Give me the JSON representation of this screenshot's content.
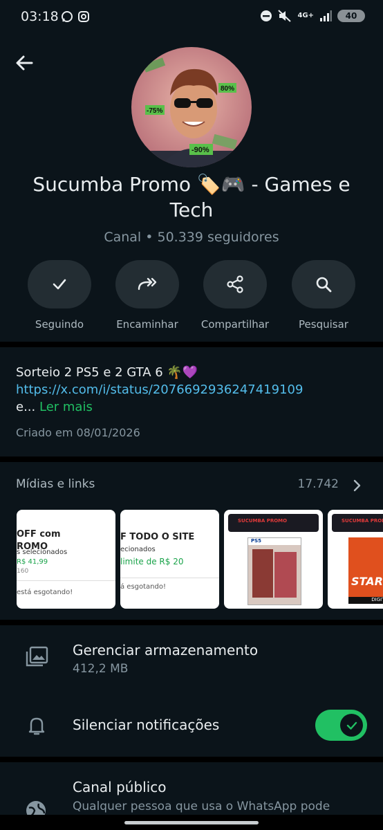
{
  "status_bar": {
    "time": "03:18",
    "network": "4G+",
    "battery": "40"
  },
  "channel": {
    "name": "Sucumba Promo 🏷️🎮  - Games e Tech",
    "subtitle": "Canal • 50.339 seguidores",
    "avatar_badges": [
      "80%",
      "-75%",
      "-90%"
    ]
  },
  "actions": [
    {
      "label": "Seguindo",
      "icon": "check-icon"
    },
    {
      "label": "Encaminhar",
      "icon": "forward-icon"
    },
    {
      "label": "Compartilhar",
      "icon": "share-icon"
    },
    {
      "label": "Pesquisar",
      "icon": "search-icon"
    }
  ],
  "description": {
    "text": "Sorteio 2 PS5 e 2 GTA 6 🌴💜",
    "link": "https://x.com/i/status/2076692936247419109",
    "ellipsis": "e...",
    "more": "Ler mais",
    "created": "Criado em 08/01/2026"
  },
  "media": {
    "header": "Mídias e links",
    "count": "17.742",
    "thumbs": [
      {
        "line1": "OFF com",
        "line2": "ROMO",
        "line3": "s selecionados",
        "price": "R$ 41,99",
        "old": "160",
        "footer": "está esgotando!"
      },
      {
        "line1": "F TODO O SITE",
        "line3": "ecionados",
        "price": "limite de R$ 20",
        "footer": "á esgotando!"
      },
      {
        "brand": "SUCUMBA PROMO",
        "platform": "PS5"
      },
      {
        "brand": "SUCUMBA PROMO",
        "game_text": "STAR",
        "tag": "DIGITA"
      }
    ]
  },
  "settings": {
    "storage_title": "Gerenciar armazenamento",
    "storage_size": "412,2 MB",
    "mute_title": "Silenciar notificações",
    "mute_enabled": true,
    "public_title": "Canal público",
    "public_sub": "Qualquer pessoa que usa o WhatsApp pode"
  },
  "colors": {
    "background": "#0b141a",
    "accent_green": "#21c063",
    "link_blue": "#53bdeb",
    "muted_text": "#8696a0"
  }
}
